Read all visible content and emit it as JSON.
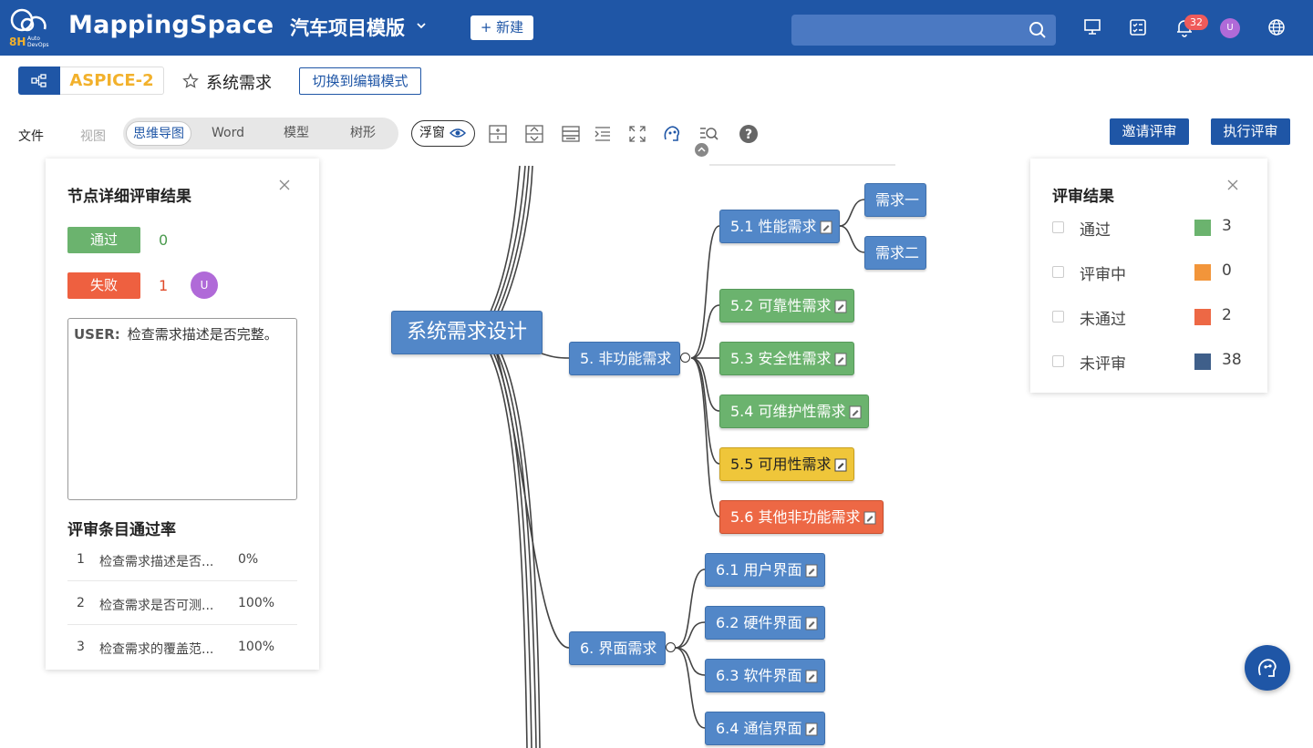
{
  "header": {
    "logo_text": "MappingSpace",
    "logo_sub": "8H",
    "logo_sub2": "Auto DevOps",
    "project_name": "汽车项目模版",
    "new_button": "+ 新建",
    "search_placeholder": "",
    "notification_count": "32",
    "avatar_initial": "U"
  },
  "title_row": {
    "project_tag": "ASPICE-2",
    "page_title": "系统需求",
    "switch_button": "切换到编辑模式"
  },
  "toolbar": {
    "file_menu": "文件",
    "view_menu": "视图",
    "view_tabs": [
      "思维导图",
      "Word",
      "模型",
      "树形"
    ],
    "active_tab": "思维导图",
    "float_button": "浮窗",
    "invite_review": "邀请评审",
    "execute_review": "执行评审"
  },
  "left_panel": {
    "title": "节点详细评审结果",
    "pass_label": "通过",
    "pass_count": "0",
    "fail_label": "失败",
    "fail_count": "1",
    "fail_avatar": "U",
    "comment_user": "USER:",
    "comment_text": "检查需求描述是否完整。",
    "rate_title": "评审条目通过率",
    "rate_rows": [
      {
        "index": "1",
        "item": "检查需求描述是否...",
        "rate": "0%"
      },
      {
        "index": "2",
        "item": "检查需求是否可测...",
        "rate": "100%"
      },
      {
        "index": "3",
        "item": "检查需求的覆盖范...",
        "rate": "100%"
      }
    ]
  },
  "right_panel": {
    "title": "评审结果",
    "rows": [
      {
        "label": "通过",
        "color": "#6bb36e",
        "count": "3"
      },
      {
        "label": "评审中",
        "color": "#f2953a",
        "count": "0"
      },
      {
        "label": "未通过",
        "color": "#ed6845",
        "count": "2"
      },
      {
        "label": "未评审",
        "color": "#3f5f8a",
        "count": "38"
      }
    ]
  },
  "mindmap": {
    "root": "系统需求设计",
    "node_5": "5. 非功能需求",
    "node_5_1": "5.1 性能需求",
    "node_5_1_a": "需求一",
    "node_5_1_b": "需求二",
    "node_5_2": "5.2 可靠性需求",
    "node_5_3": "5.3 安全性需求",
    "node_5_4": "5.4 可维护性需求",
    "node_5_5": "5.5 可用性需求",
    "node_5_6": "5.6 其他非功能需求",
    "node_6": "6. 界面需求",
    "node_6_1": "6.1 用户界面",
    "node_6_2": "6.2 硬件界面",
    "node_6_3": "6.3 软件界面",
    "node_6_4": "6.4 通信界面"
  }
}
